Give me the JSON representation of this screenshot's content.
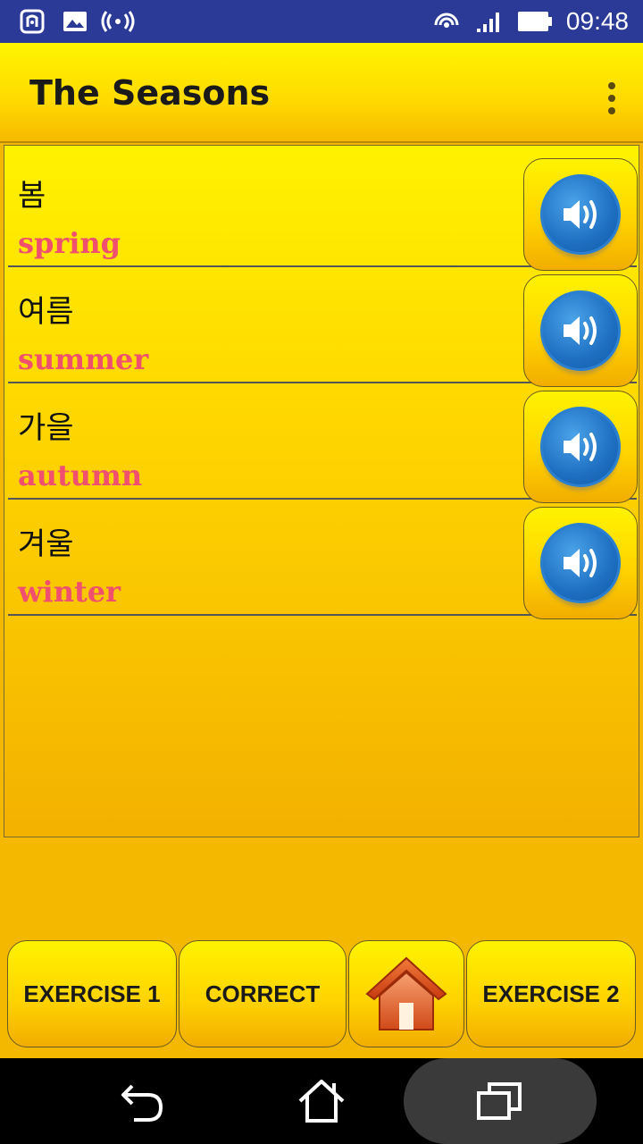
{
  "status_bar": {
    "time": "09:48",
    "icons_left": [
      "nfc-icon",
      "image-icon",
      "hotspot-icon"
    ],
    "icons_right": [
      "wifi-icon",
      "signal-icon",
      "battery-icon"
    ]
  },
  "app_bar": {
    "title": "The Seasons",
    "menu_icon": "overflow-menu-icon"
  },
  "words": [
    {
      "korean": "봄",
      "english": "spring",
      "icon": "speaker-icon"
    },
    {
      "korean": "여름",
      "english": "summer",
      "icon": "speaker-icon"
    },
    {
      "korean": "가을",
      "english": "autumn",
      "icon": "speaker-icon"
    },
    {
      "korean": "겨울",
      "english": "winter",
      "icon": "speaker-icon"
    }
  ],
  "bottom_bar": {
    "exercise1_label": "EXERCISE 1",
    "correct_label": "CORRECT",
    "home_icon": "home-icon",
    "exercise2_label": "EXERCISE 2"
  },
  "nav_bar": {
    "icons": [
      "back-icon",
      "home-icon",
      "recents-icon"
    ]
  },
  "colors": {
    "status_bar": "#2b3a97",
    "english_text": "#f0506e",
    "accent_yellow": "#ffd600"
  }
}
